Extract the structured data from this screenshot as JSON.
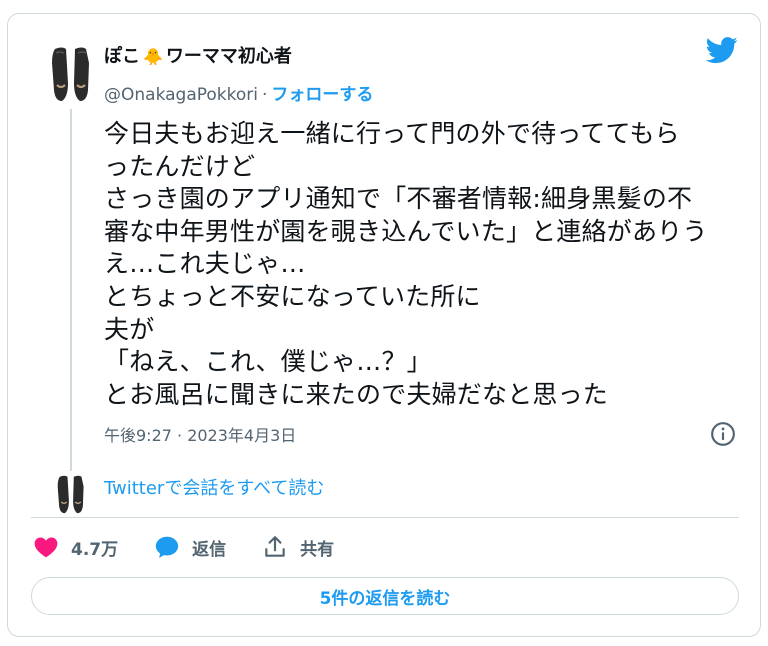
{
  "user": {
    "name_part1": "ぽこ",
    "chick_emoji": "🐥",
    "name_part2": "ワーママ初心者",
    "handle": "@OnakagaPokkori",
    "separator": "·",
    "follow_label": "フォローする",
    "avatar_icon": "shoes-avatar-icon"
  },
  "tweet": {
    "lines": [
      "今日夫もお迎え一緒に行って門の外で待っててもら",
      "ったんだけど",
      "さっき園のアプリ通知で「不審者情報:細身黒髪の不",
      "審な中年男性が園を覗き込んでいた」と連絡がありう",
      "え…これ夫じゃ…",
      "とちょっと不安になっていた所に",
      "夫が",
      "「ねえ、これ、僕じゃ…？」",
      "とお風呂に聞きに来たので夫婦だなと思った"
    ],
    "timestamp": "午後9:27 · 2023年4月3日"
  },
  "conversation_link": "Twitterで会話をすべて読む",
  "actions": {
    "like_count": "4.7万",
    "reply_label": "返信",
    "share_label": "共有"
  },
  "replies_button": "5件の返信を読む",
  "colors": {
    "twitter_blue": "#1d9bf0",
    "like_pink": "#f91880",
    "text_dark": "#0f1419",
    "text_muted": "#536471",
    "border": "#cfd9de"
  }
}
